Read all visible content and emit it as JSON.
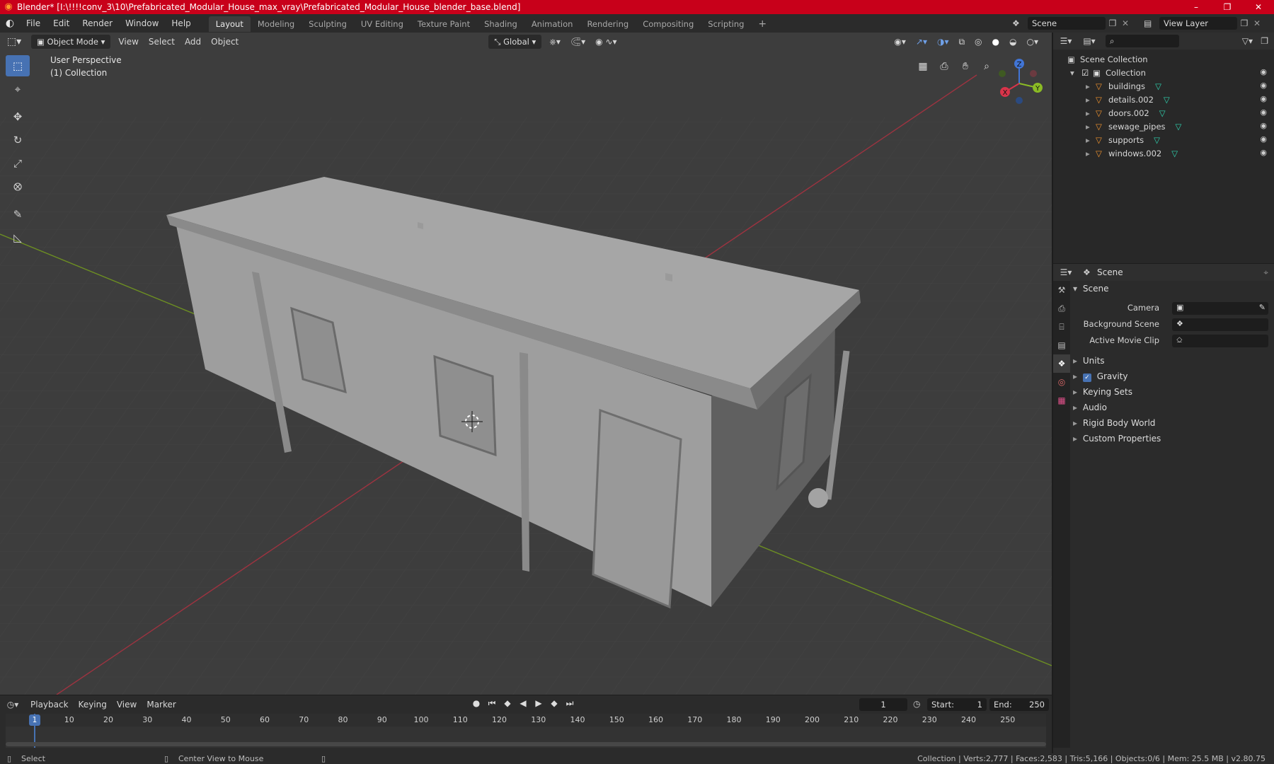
{
  "window": {
    "title": "Blender* [I:\\!!!!conv_3\\10\\Prefabricated_Modular_House_max_vray\\Prefabricated_Modular_House_blender_base.blend]",
    "minimize": "–",
    "maximize": "❐",
    "close": "✕"
  },
  "menu": [
    "File",
    "Edit",
    "Render",
    "Window",
    "Help"
  ],
  "workspaces": [
    {
      "label": "Layout",
      "active": true
    },
    {
      "label": "Modeling"
    },
    {
      "label": "Sculpting"
    },
    {
      "label": "UV Editing"
    },
    {
      "label": "Texture Paint"
    },
    {
      "label": "Shading"
    },
    {
      "label": "Animation"
    },
    {
      "label": "Rendering"
    },
    {
      "label": "Compositing"
    },
    {
      "label": "Scripting"
    }
  ],
  "add_workspace": "+",
  "scene_selector": "Scene",
  "view_layer": "View Layer",
  "viewport": {
    "mode": "Object Mode",
    "menus": [
      "View",
      "Select",
      "Add",
      "Object"
    ],
    "transform_orientation": "Global",
    "perspective_label": "User Perspective",
    "collection_label": "(1) Collection",
    "gizmo_axes": {
      "x": "X",
      "y": "Y",
      "z": "Z"
    }
  },
  "outliner": {
    "root": "Scene Collection",
    "collection": "Collection",
    "items": [
      {
        "name": "buildings"
      },
      {
        "name": "details.002"
      },
      {
        "name": "doors.002"
      },
      {
        "name": "sewage_pipes"
      },
      {
        "name": "supports"
      },
      {
        "name": "windows.002"
      }
    ]
  },
  "properties": {
    "header": "Scene",
    "panel_title": "Scene",
    "camera_label": "Camera",
    "background_scene_label": "Background Scene",
    "active_movie_clip_label": "Active Movie Clip",
    "subpanels": [
      {
        "label": "Units",
        "checkbox": false
      },
      {
        "label": "Gravity",
        "checkbox": true
      },
      {
        "label": "Keying Sets",
        "checkbox": false
      },
      {
        "label": "Audio",
        "checkbox": false
      },
      {
        "label": "Rigid Body World",
        "checkbox": false
      },
      {
        "label": "Custom Properties",
        "checkbox": false
      }
    ]
  },
  "timeline": {
    "menus": [
      "Playback",
      "Keying",
      "View",
      "Marker"
    ],
    "current_frame": "1",
    "start_label": "Start:",
    "start_value": "1",
    "end_label": "End:",
    "end_value": "250",
    "ticks": [
      "1",
      "10",
      "20",
      "30",
      "40",
      "50",
      "60",
      "70",
      "80",
      "90",
      "100",
      "110",
      "120",
      "130",
      "140",
      "150",
      "160",
      "170",
      "180",
      "190",
      "200",
      "210",
      "220",
      "230",
      "240",
      "250"
    ]
  },
  "status": {
    "select": "Select",
    "center_view": "Center View to Mouse",
    "stats": "Collection | Verts:2,777 | Faces:2,583 | Tris:5,166 | Objects:0/6 | Mem: 25.5 MB | v2.80.75"
  },
  "colors": {
    "title_bar": "#c8001a",
    "accent": "#4772b3",
    "x_axis": "#d9344a",
    "y_axis": "#8bbb25",
    "z_axis": "#4175d6"
  }
}
